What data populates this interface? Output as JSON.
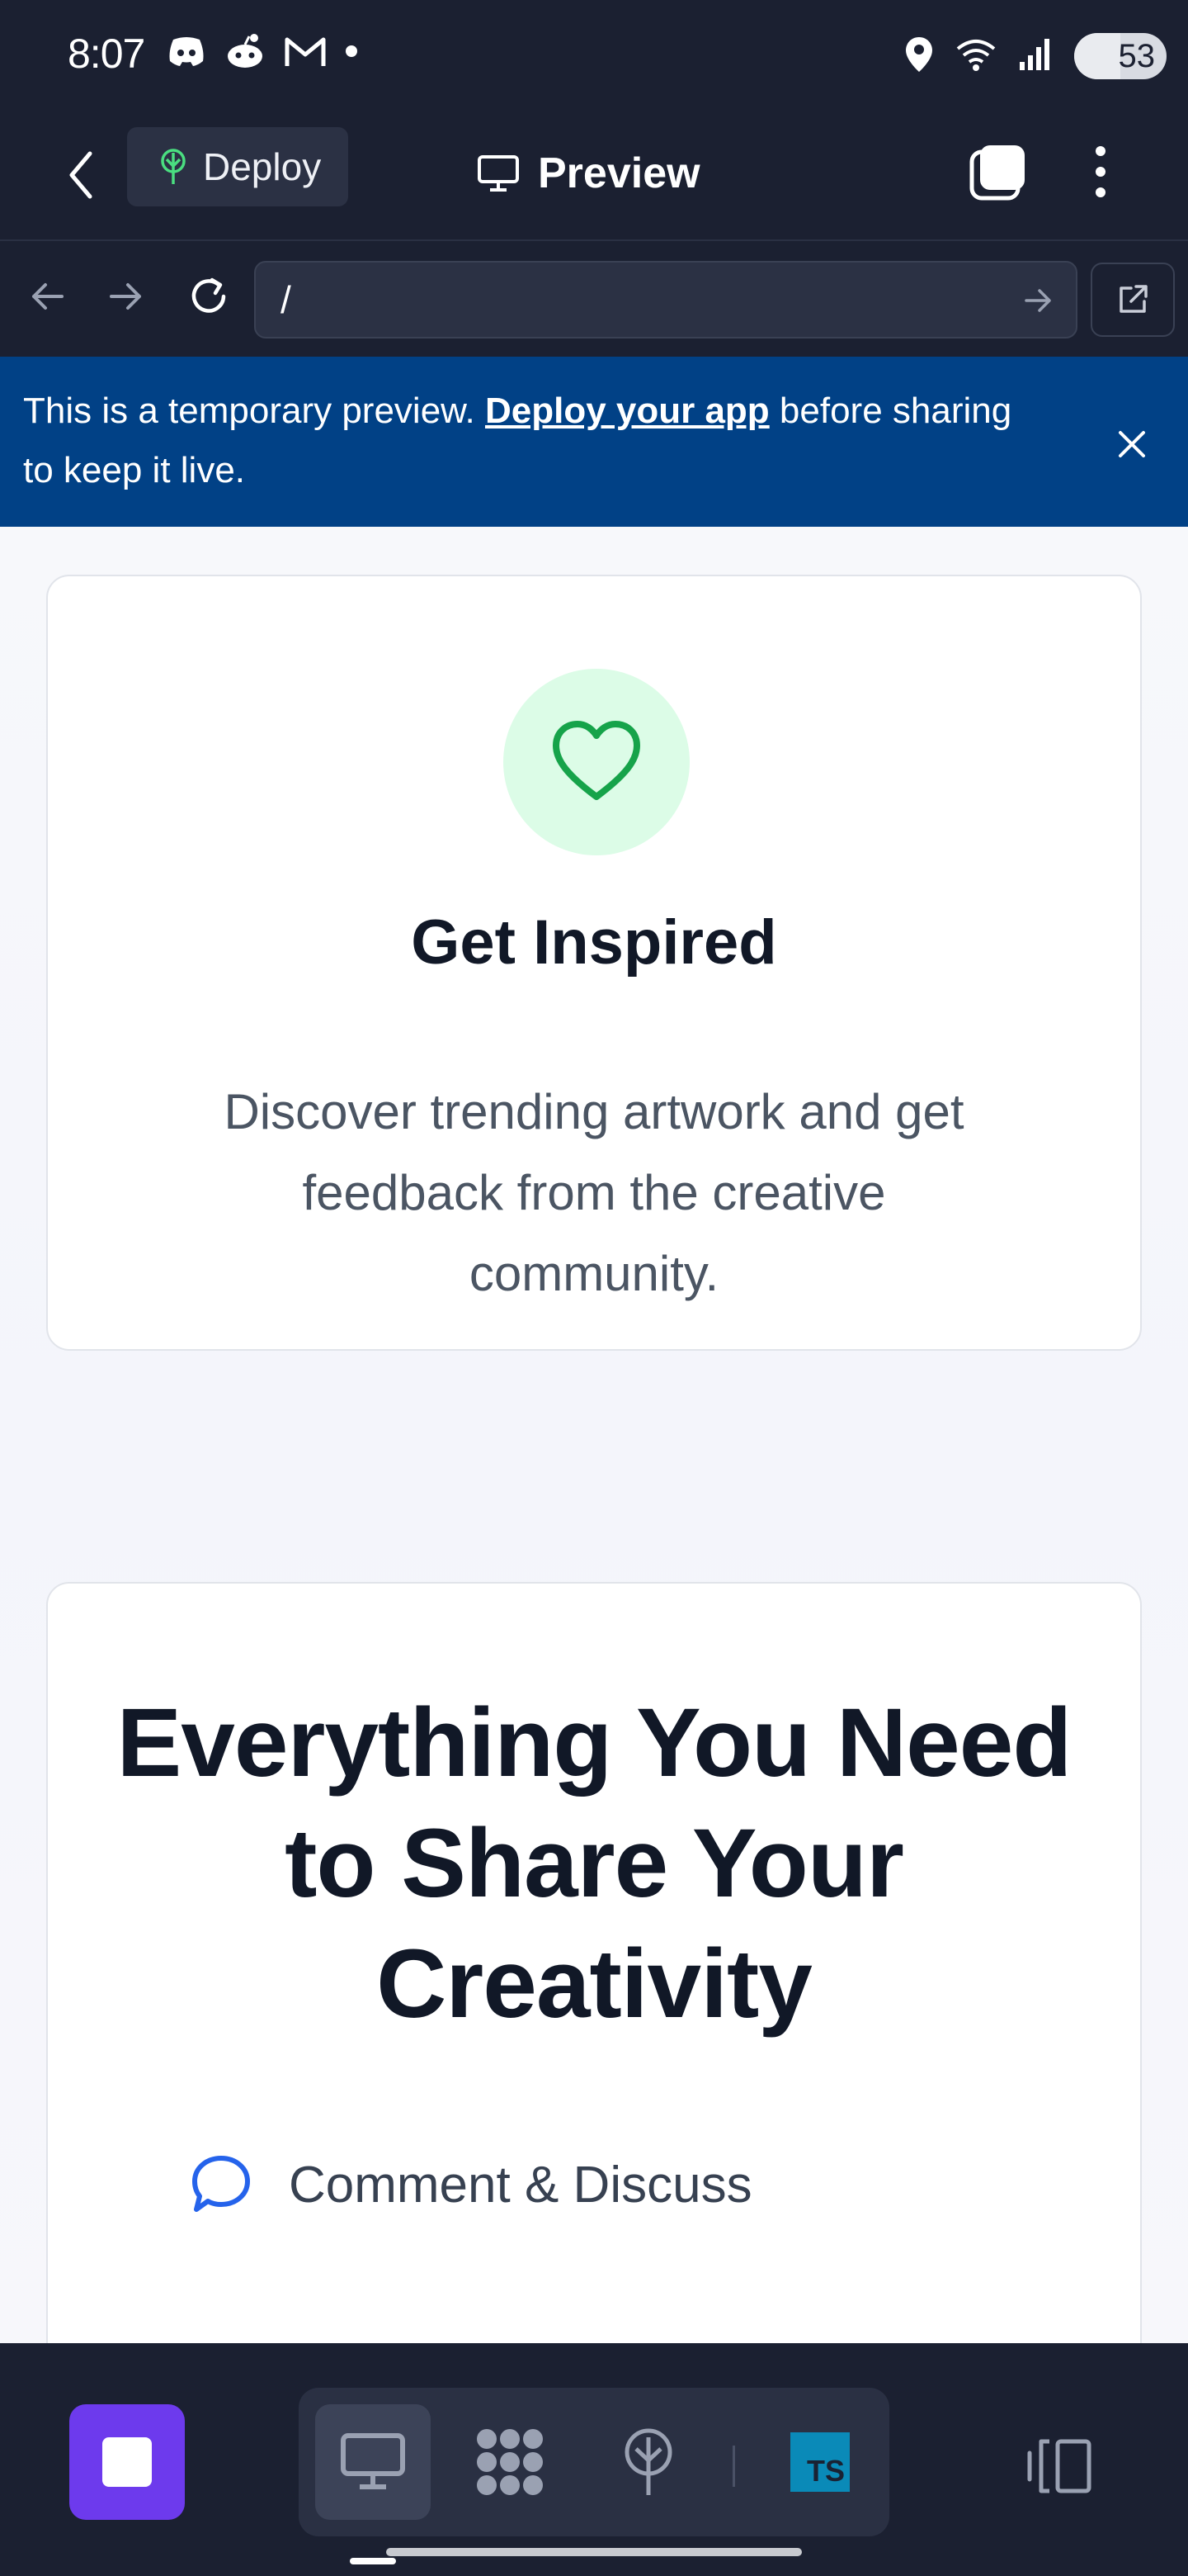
{
  "status_bar": {
    "time": "8:07",
    "left_icons": [
      "discord-icon",
      "reddit-icon",
      "gmail-icon",
      "dot-icon"
    ],
    "right_icons": [
      "location-icon",
      "wifi-icon",
      "signal-icon"
    ],
    "battery": "53"
  },
  "header": {
    "deploy_label": "Deploy",
    "title": "Preview",
    "colors": {
      "background": "#1b2031",
      "deploy_icon": "#4ade80"
    }
  },
  "url_bar": {
    "value": "/"
  },
  "banner": {
    "text_before": "This is a temporary preview. ",
    "link": "Deploy your app",
    "text_after": " before sharing to keep it live.",
    "color": "#014186"
  },
  "inspired_card": {
    "icon": "heart-icon",
    "title": "Get Inspired",
    "description": "Discover trending artwork and get feedback from the creative community.",
    "accent": "#16a34a"
  },
  "features": {
    "title": "Everything You Need to Share Your Creativity",
    "items": [
      {
        "icon": "chat-bubble-icon",
        "label": "Comment & Discuss"
      }
    ]
  },
  "toolbar": {
    "stop_color": "#6d3aed",
    "tools": [
      "monitor-icon",
      "apps-grid-icon",
      "deploy-tree-icon",
      "typescript-icon"
    ],
    "ts_label": "TS"
  }
}
